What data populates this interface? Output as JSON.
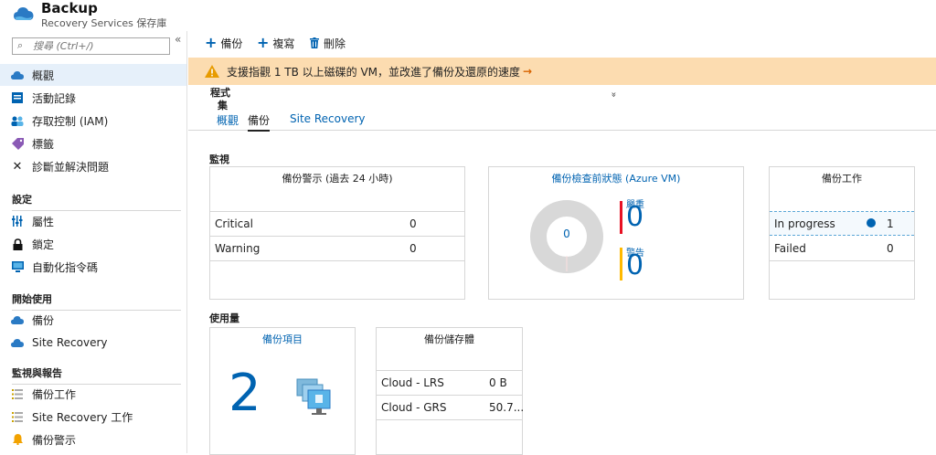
{
  "header": {
    "title": "Backup",
    "subtitle": "Recovery Services 保存庫"
  },
  "sidebar": {
    "search_placeholder": "搜尋 (Ctrl+/)",
    "collapse_glyph": "«",
    "items": [
      {
        "label": "概觀",
        "icon": "cloud-icon"
      },
      {
        "label": "活動記錄",
        "icon": "activity-log-icon"
      },
      {
        "label": "存取控制 (IAM)",
        "icon": "people-icon"
      },
      {
        "label": "標籤",
        "icon": "tag-icon"
      },
      {
        "label": "診斷並解決問題",
        "icon": "wrench-icon"
      }
    ],
    "sections": [
      {
        "title": "設定",
        "items": [
          {
            "label": "屬性",
            "icon": "properties-icon"
          },
          {
            "label": "鎖定",
            "icon": "lock-icon"
          },
          {
            "label": "自動化指令碼",
            "icon": "script-icon"
          }
        ]
      },
      {
        "title": "開始使用",
        "items": [
          {
            "label": "備份",
            "icon": "cloud-icon"
          },
          {
            "label": "Site Recovery",
            "icon": "cloud-icon"
          }
        ]
      },
      {
        "title": "監視與報告",
        "items": [
          {
            "label": "備份工作",
            "icon": "list-icon"
          },
          {
            "label": "Site Recovery 工作",
            "icon": "list-icon"
          },
          {
            "label": "備份警示",
            "icon": "bell-icon"
          }
        ]
      }
    ]
  },
  "toolbar": {
    "backup_label": "備份",
    "replicate_label": "複寫",
    "delete_label": "刪除"
  },
  "banner": {
    "message": "支援指觀 1 TB 以上磁碟的 VM，並改進了備份及還原的速度",
    "arrow": "→"
  },
  "fragments": {
    "line1": "程式",
    "line2": "集",
    "chevron": "»"
  },
  "tabs": [
    "概觀",
    "備份",
    "Site Recovery"
  ],
  "monitor": {
    "title": "監視",
    "alerts": {
      "title": "備份警示 (過去 24 小時)",
      "rows": [
        {
          "label": "Critical",
          "value": "0"
        },
        {
          "label": "Warning",
          "value": "0"
        }
      ]
    },
    "precheck": {
      "title": "備份檢查前狀態 (Azure VM)",
      "donut_value": "0",
      "critical_label": "嚴重",
      "critical_value": "0",
      "warning_label": "警告",
      "warning_value": "0"
    },
    "jobs": {
      "title": "備份工作",
      "rows": [
        {
          "label": "In progress",
          "value": "1"
        },
        {
          "label": "Failed",
          "value": "0"
        }
      ]
    }
  },
  "usage": {
    "title": "使用量",
    "items": {
      "title": "備份項目",
      "count": "2"
    },
    "storage": {
      "title": "備份儲存體",
      "rows": [
        {
          "label": "Cloud - LRS",
          "value": "0 B"
        },
        {
          "label": "Cloud - GRS",
          "value": "50.7..."
        }
      ]
    }
  },
  "colors": {
    "accent": "#0063b1",
    "critical": "#e81123",
    "warning": "#ffb900",
    "banner": "#fcdcb0"
  }
}
